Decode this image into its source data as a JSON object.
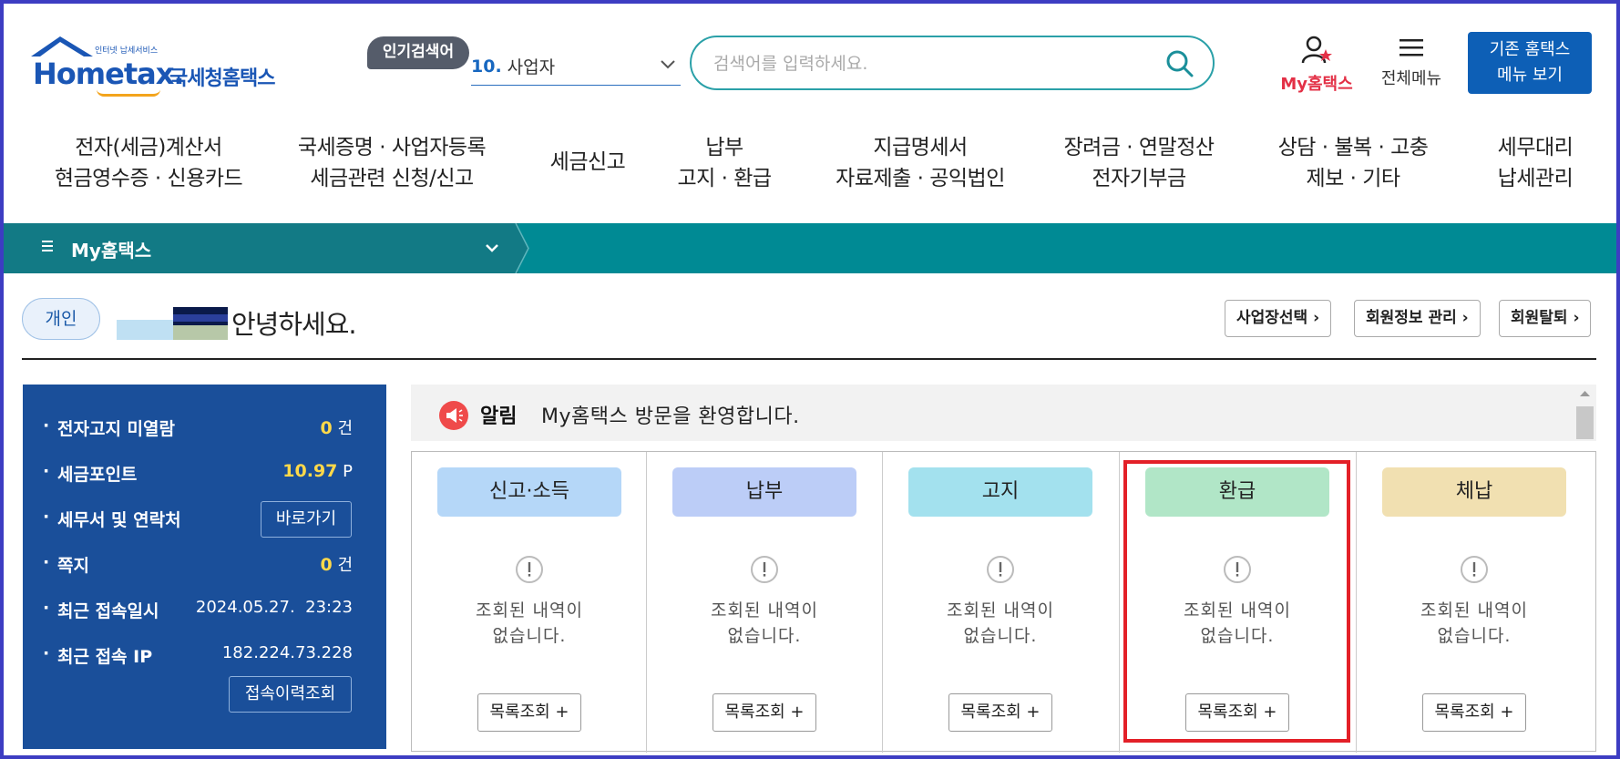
{
  "header": {
    "logo_tiny": "인터넷 납세서비스",
    "logo_home": "Home",
    "logo_tax": "tax.",
    "logo_kname": "국세청홈택스",
    "popular_badge": "인기검색어",
    "popular_num": "10.",
    "popular_keyword": "사업자",
    "search_placeholder": "검색어를 입력하세요.",
    "my_hometax": "My홈택스",
    "all_menu": "전체메뉴",
    "old_menu_line1": "기존 홈택스",
    "old_menu_line2": "메뉴 보기",
    "accent": "#0d5fb6"
  },
  "gnb": [
    {
      "l1": "전자(세금)계산서",
      "l2": "현금영수증 · 신용카드"
    },
    {
      "l1": "국세증명 · 사업자등록",
      "l2": "세금관련 신청/신고"
    },
    {
      "l1": "세금신고",
      "l2": ""
    },
    {
      "l1": "납부",
      "l2": "고지 · 환급"
    },
    {
      "l1": "지급명세서",
      "l2": "자료제출 · 공익법인"
    },
    {
      "l1": "장려금 · 연말정산",
      "l2": "전자기부금"
    },
    {
      "l1": "상담 · 불복 · 고충",
      "l2": "제보 · 기타"
    },
    {
      "l1": "세무대리",
      "l2": "납세관리"
    }
  ],
  "bar": {
    "label": "My홈택스",
    "color": "#008a94"
  },
  "greeting": {
    "tag": "개인",
    "text": "안녕하세요.",
    "btn_business": "사업장선택 ›",
    "btn_member": "회원정보 관리 ›",
    "btn_withdraw": "회원탈퇴 ›"
  },
  "summary": {
    "rows": [
      {
        "label": "전자고지 미열람",
        "num": "0",
        "unit": "건"
      },
      {
        "label": "세금포인트",
        "num": "10.97",
        "unit": "P"
      },
      {
        "label": "세무서 및 연락처",
        "num": "",
        "unit": ""
      },
      {
        "label": "쪽지",
        "num": "0",
        "unit": "건"
      },
      {
        "label": "최근 접속일시",
        "num": "",
        "unit": "2024.05.27.  23:23"
      },
      {
        "label": "최근 접속 IP",
        "num": "",
        "unit": "182.224.73.228"
      }
    ],
    "btn_shortcut": "바로가기",
    "btn_history": "접속이력조회"
  },
  "notice": {
    "label": "알림",
    "text": "My홈택스 방문을 환영합니다."
  },
  "cards": [
    {
      "title": "신고·소득",
      "color": "#b5d7f8",
      "msg1": "조회된 내역이",
      "msg2": "없습니다.",
      "btn": "목록조회 +"
    },
    {
      "title": "납부",
      "color": "#bccdf7",
      "msg1": "조회된 내역이",
      "msg2": "없습니다.",
      "btn": "목록조회 +"
    },
    {
      "title": "고지",
      "color": "#a3e1ee",
      "msg1": "조회된 내역이",
      "msg2": "없습니다.",
      "btn": "목록조회 +"
    },
    {
      "title": "환급",
      "color": "#b1e6c7",
      "msg1": "조회된 내역이",
      "msg2": "없습니다.",
      "btn": "목록조회 +"
    },
    {
      "title": "체납",
      "color": "#f1e0b1",
      "msg1": "조회된 내역이",
      "msg2": "없습니다.",
      "btn": "목록조회 +"
    }
  ]
}
